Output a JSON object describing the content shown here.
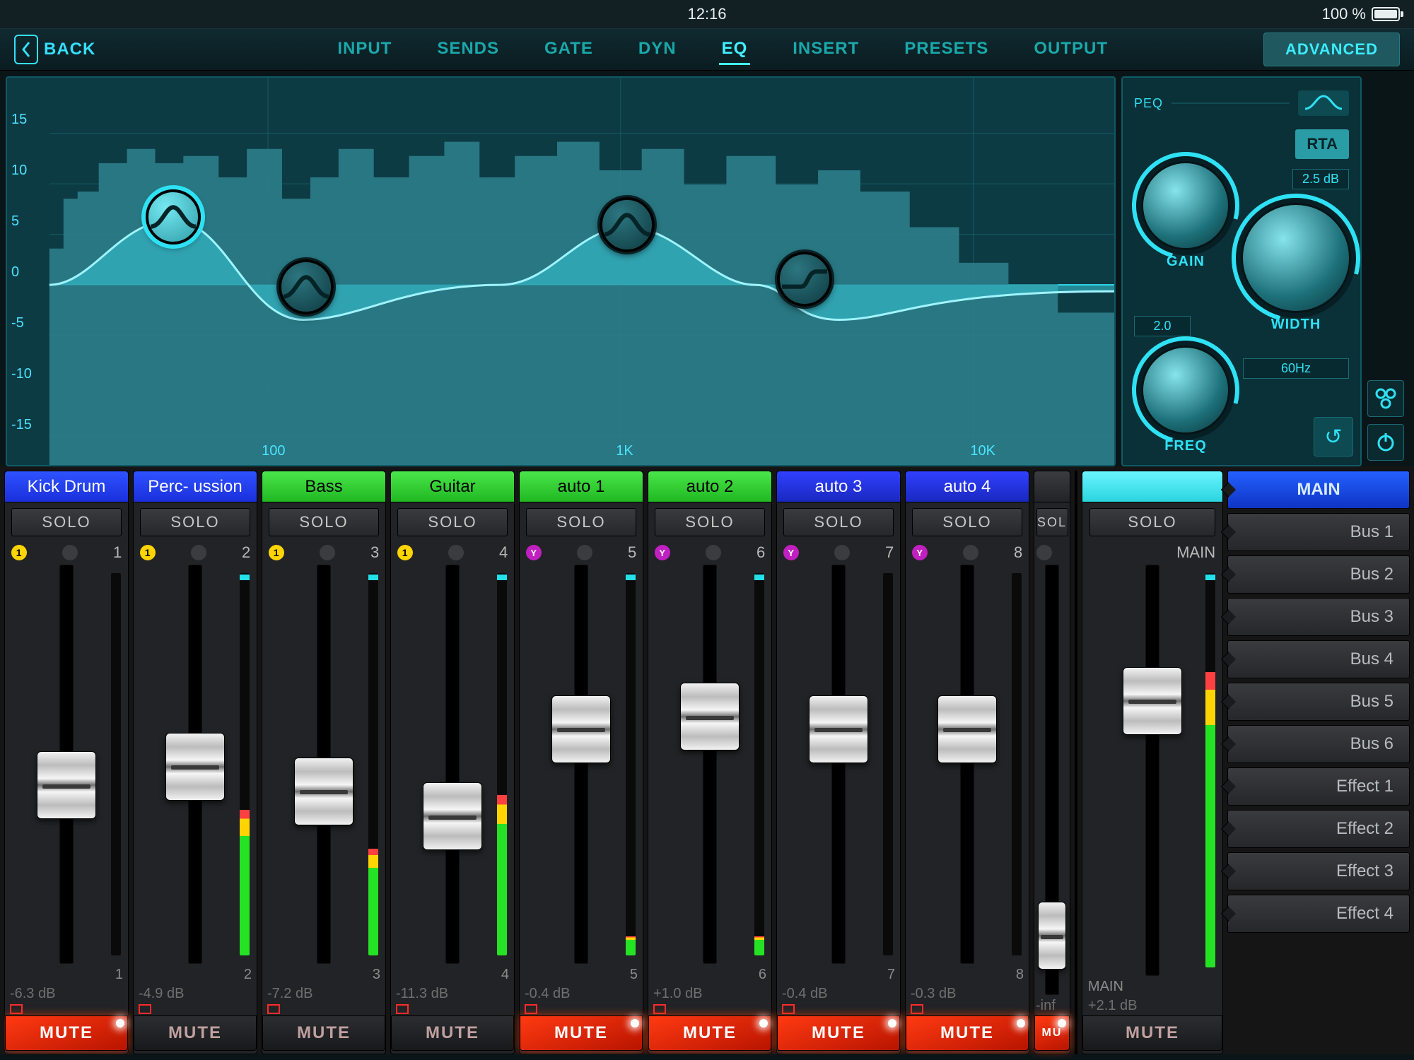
{
  "status": {
    "time": "12:16",
    "battery_text": "100 %"
  },
  "nav": {
    "back": "BACK",
    "tabs": [
      "INPUT",
      "SENDS",
      "GATE",
      "DYN",
      "EQ",
      "INSERT",
      "PRESETS",
      "OUTPUT"
    ],
    "active": "EQ",
    "advanced": "ADVANCED"
  },
  "eq": {
    "y_ticks": [
      "15",
      "10",
      "5",
      "0",
      "-5",
      "-10",
      "-15"
    ],
    "x_ticks": [
      "100",
      "1K",
      "10K"
    ],
    "peq_label": "PEQ",
    "rta": "RTA",
    "knobs": {
      "gain": {
        "label": "GAIN",
        "value": "2.5 dB"
      },
      "width": {
        "label": "WIDTH",
        "value": "2.0"
      },
      "freq": {
        "label": "FREQ",
        "value": "60Hz"
      }
    },
    "handles": [
      {
        "x_pct": 15,
        "y_pct": 36,
        "shape": "bell",
        "active": true
      },
      {
        "x_pct": 27,
        "y_pct": 54,
        "shape": "bell",
        "active": false
      },
      {
        "x_pct": 56,
        "y_pct": 38,
        "shape": "bell",
        "active": false
      },
      {
        "x_pct": 72,
        "y_pct": 52,
        "shape": "shelf",
        "active": false
      }
    ]
  },
  "mixer": {
    "solo_label": "SOLO",
    "mute_label": "MUTE",
    "channels": [
      {
        "n": "1",
        "name": "Kick Drum",
        "color": "blue",
        "dot": "y",
        "fader": 0.4,
        "meter": 0.0,
        "db": "-6.3  dB",
        "mute": true
      },
      {
        "n": "2",
        "name": "Perc- ussion",
        "color": "blue",
        "dot": "y",
        "fader": 0.46,
        "meter": 0.38,
        "db": "-4.9  dB",
        "mute": false
      },
      {
        "n": "3",
        "name": "Bass",
        "color": "green",
        "dot": "y",
        "fader": 0.38,
        "meter": 0.28,
        "db": "-7.2  dB",
        "mute": false
      },
      {
        "n": "4",
        "name": "Guitar",
        "color": "green",
        "dot": "y",
        "fader": 0.3,
        "meter": 0.42,
        "db": "-11.3  dB",
        "mute": false
      },
      {
        "n": "5",
        "name": "auto 1",
        "color": "green",
        "dot": "m",
        "fader": 0.58,
        "meter": 0.05,
        "db": "-0.4  dB",
        "mute": true
      },
      {
        "n": "6",
        "name": "auto 2",
        "color": "green",
        "dot": "m",
        "fader": 0.62,
        "meter": 0.05,
        "db": "+1.0  dB",
        "mute": true
      },
      {
        "n": "7",
        "name": "auto 3",
        "color": "dblue",
        "dot": "m",
        "fader": 0.58,
        "meter": 0.0,
        "db": "-0.4  dB",
        "mute": true
      },
      {
        "n": "8",
        "name": "auto 4",
        "color": "dblue",
        "dot": "m",
        "fader": 0.58,
        "meter": 0.0,
        "db": "-0.3  dB",
        "mute": true
      }
    ],
    "clipped": {
      "name": "",
      "color": "dark",
      "solo": "SOL",
      "db": "-inf",
      "mute": "MU",
      "fader": 0.02
    },
    "main": {
      "name": "",
      "color": "cyan",
      "label": "MAIN",
      "solo": "SOLO",
      "fader": 0.68,
      "meter": 0.75,
      "db": "+2.1  dB",
      "mute": false
    },
    "buses": [
      "MAIN",
      "Bus 1",
      "Bus 2",
      "Bus 3",
      "Bus 4",
      "Bus 5",
      "Bus 6",
      "Effect 1",
      "Effect 2",
      "Effect 3",
      "Effect 4"
    ]
  }
}
